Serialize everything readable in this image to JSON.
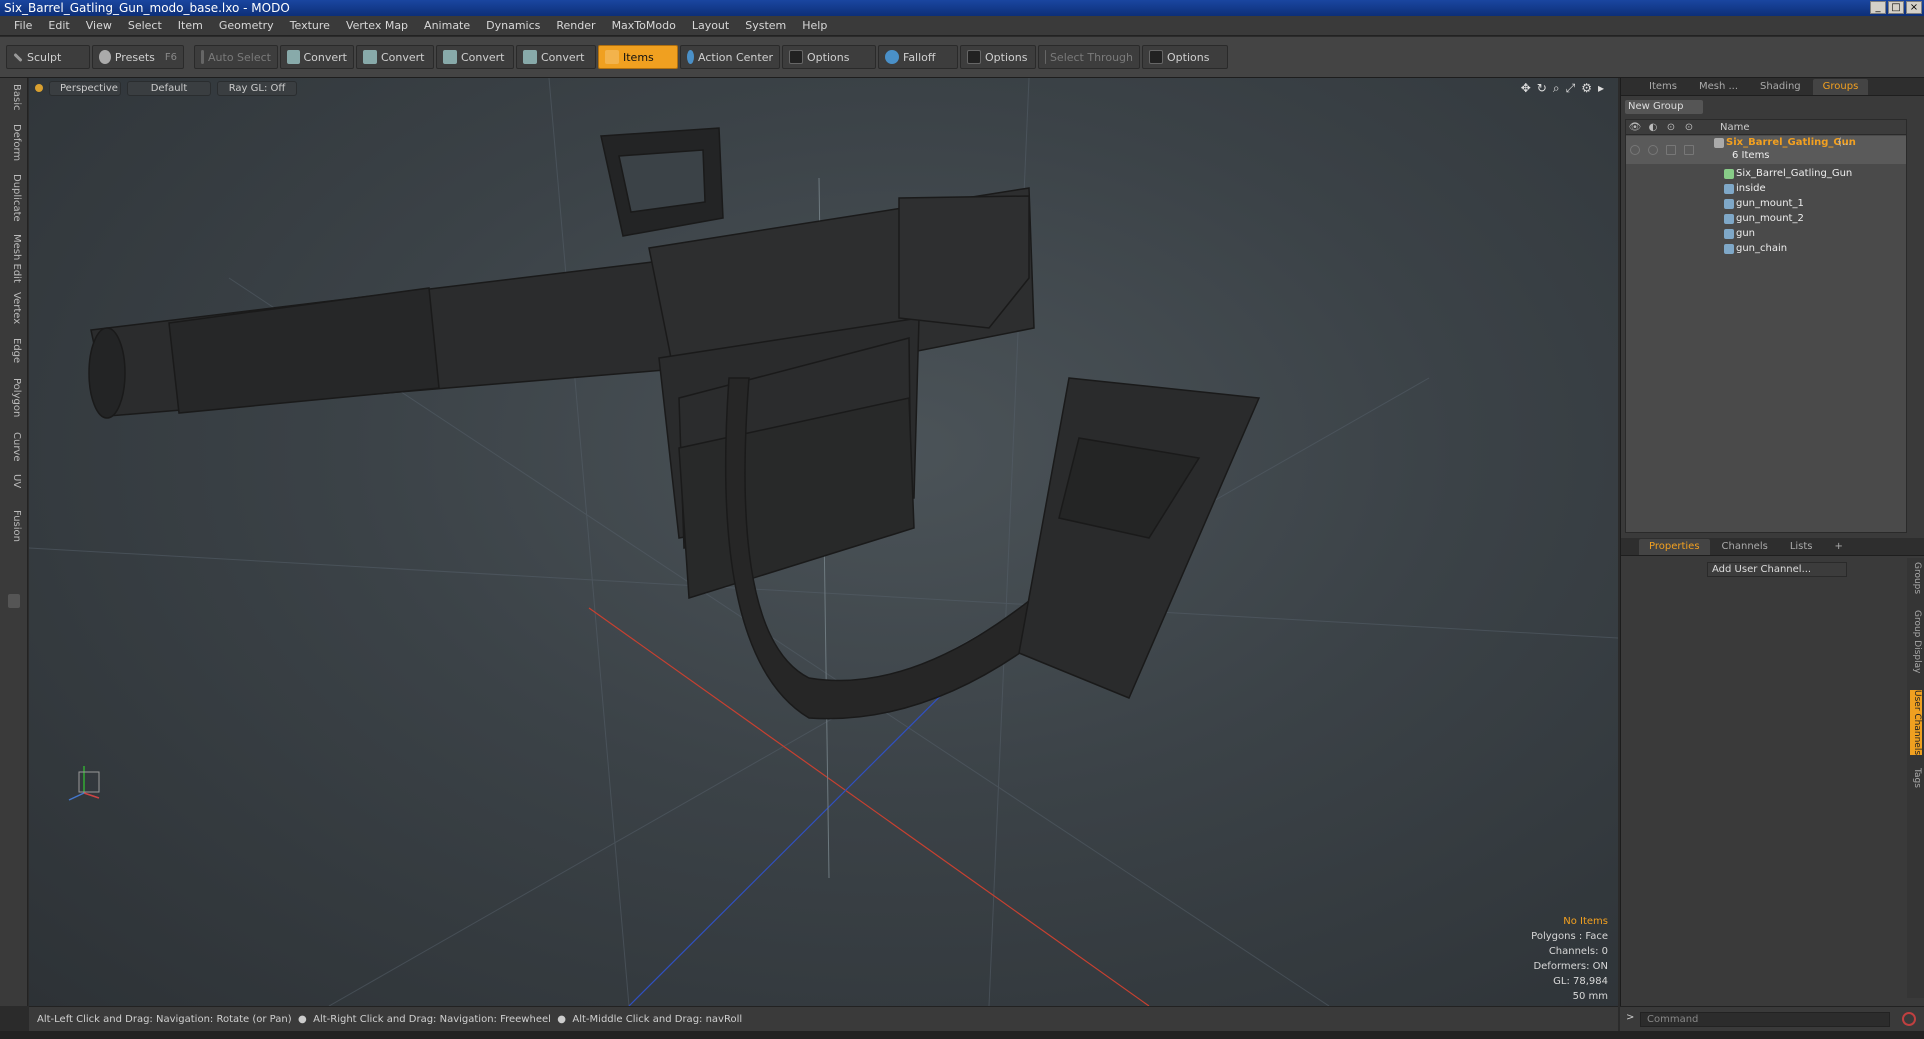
{
  "window": {
    "title": "Six_Barrel_Gatling_Gun_modo_base.lxo - MODO"
  },
  "menu": [
    "File",
    "Edit",
    "View",
    "Select",
    "Item",
    "Geometry",
    "Texture",
    "Vertex Map",
    "Animate",
    "Dynamics",
    "Render",
    "MaxToModo",
    "Layout",
    "System",
    "Help"
  ],
  "toolbar": {
    "sculpt": "Sculpt",
    "presets": "Presets",
    "presets_key": "F6",
    "auto_select": "Auto Select",
    "convert1": "Convert",
    "convert2": "Convert",
    "convert3": "Convert",
    "convert4": "Convert",
    "items": "Items",
    "action_center": "Action Center",
    "options1": "Options",
    "falloff": "Falloff",
    "options2": "Options",
    "select_through": "Select Through",
    "options3": "Options"
  },
  "left_tabs": [
    "Basic",
    "Deform",
    "Duplicate",
    "Mesh Edit",
    "Vertex",
    "Edge",
    "Polygon",
    "Curve",
    "UV",
    "Fusion"
  ],
  "viewport": {
    "view": "Perspective",
    "shading": "Default",
    "raygl": "Ray GL: Off",
    "info": {
      "items": "No Items",
      "polygons": "Polygons : Face",
      "channels": "Channels: 0",
      "deformers": "Deformers: ON",
      "gl": "GL: 78,984",
      "scale": "50 mm"
    }
  },
  "groups_panel": {
    "tabs": [
      "Items",
      "Mesh ...",
      "Shading",
      "Groups"
    ],
    "active_tab": "Groups",
    "new_group": "New Group",
    "name_header": "Name",
    "root": {
      "name": "Six_Barrel_Gatling_Gun",
      "suffix": "(...",
      "count": "6 Items"
    },
    "children": [
      "Six_Barrel_Gatling_Gun",
      "inside",
      "gun_mount_1",
      "gun_mount_2",
      "gun",
      "gun_chain"
    ]
  },
  "properties_panel": {
    "tabs": [
      "Properties",
      "Channels",
      "Lists"
    ],
    "active_tab": "Properties",
    "add_user_channel": "Add User Channel...",
    "side_tabs": [
      "Groups",
      "Group Display",
      "User Channels",
      "Tags"
    ],
    "active_side_tab": "User Channels"
  },
  "status": {
    "hint1": "Alt-Left Click and Drag: Navigation: Rotate (or Pan)",
    "hint2": "Alt-Right Click and Drag: Navigation: Freewheel",
    "hint3": "Alt-Middle Click and Drag: navRoll"
  },
  "command": {
    "placeholder": "Command"
  },
  "colors": {
    "accent": "#f2a020",
    "titlebar": "#1a46a0",
    "x_axis": "#c84030",
    "z_axis": "#3050c0"
  }
}
